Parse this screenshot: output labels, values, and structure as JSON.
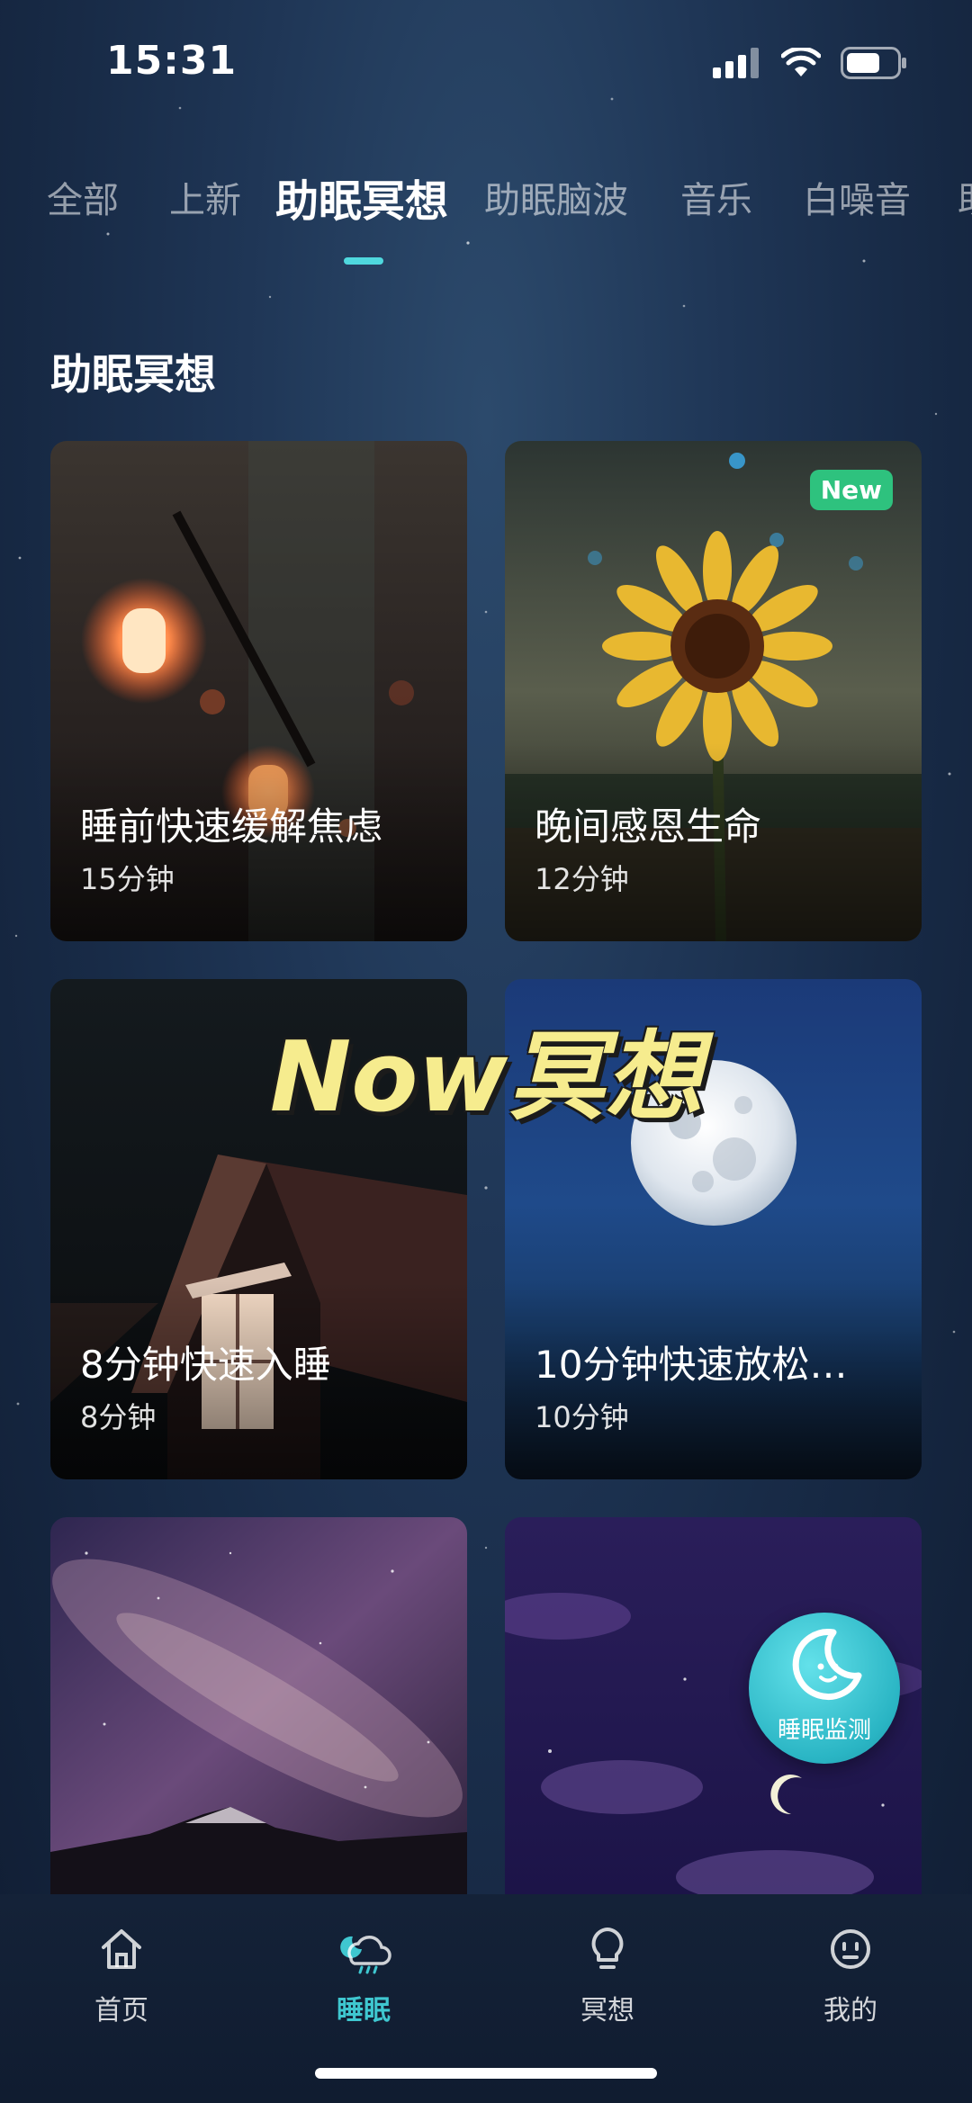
{
  "status_bar": {
    "time": "15:31"
  },
  "category_tabs": [
    {
      "label": "全部",
      "active": false
    },
    {
      "label": "上新",
      "active": false
    },
    {
      "label": "助眠冥想",
      "active": true
    },
    {
      "label": "助眠脑波",
      "active": false
    },
    {
      "label": "音乐",
      "active": false
    },
    {
      "label": "白噪音",
      "active": false
    },
    {
      "label": "助",
      "active": false
    }
  ],
  "section": {
    "title": "助眠冥想"
  },
  "cards": [
    {
      "title": "睡前快速缓解焦虑",
      "duration": "15分钟",
      "image": "string-lights-bulbs"
    },
    {
      "title": "晚间感恩生命",
      "duration": "12分钟",
      "badge": "New",
      "image": "sunflower-dusk"
    },
    {
      "title": "8分钟快速入睡",
      "duration": "8分钟",
      "image": "cabin-lit-window"
    },
    {
      "title": "10分钟快速放松…",
      "duration": "10分钟",
      "image": "full-moon-blue-sky"
    },
    {
      "title": "",
      "duration": "",
      "image": "milky-way-mountain"
    },
    {
      "title": "",
      "duration": "",
      "image": "purple-night-clouds"
    }
  ],
  "overlay_caption": "Now冥想",
  "floating_button": {
    "label": "睡眠监测",
    "icon": "moon-face-icon"
  },
  "bottom_nav": [
    {
      "label": "首页",
      "icon": "home-icon",
      "active": false
    },
    {
      "label": "睡眠",
      "icon": "sleep-cloud-moon-icon",
      "active": true
    },
    {
      "label": "冥想",
      "icon": "lightbulb-icon",
      "active": false
    },
    {
      "label": "我的",
      "icon": "profile-face-icon",
      "active": false
    }
  ],
  "colors": {
    "accent": "#3fc7d0",
    "new_badge": "#2ec27e",
    "caption": "#f6ec8e"
  }
}
